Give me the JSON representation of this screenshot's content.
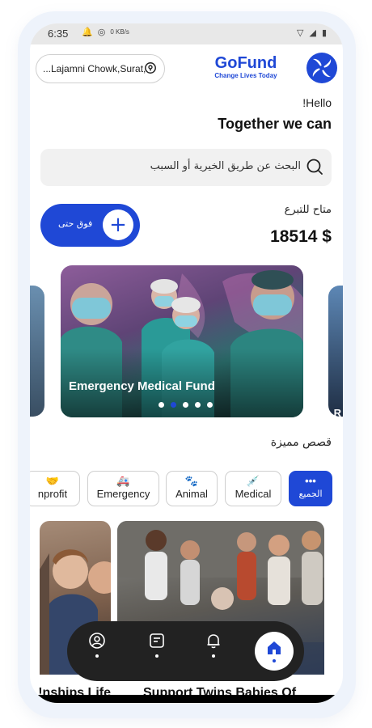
{
  "status_bar": {
    "time": "6:35",
    "network_speed": "0 KB/s"
  },
  "header": {
    "location": "...Lajamni Chowk,Surat,",
    "brand_title": "GoFund",
    "brand_tagline": "Change Lives Today"
  },
  "greeting": {
    "hello": "!Hello",
    "headline": "Together we can"
  },
  "search": {
    "placeholder": "البحث عن طريق الخيرية أو السبب"
  },
  "donate": {
    "button_label": "فوق حتى",
    "available_label": "متاح للتبرع",
    "available_amount": "18514 $"
  },
  "carousel": {
    "main_title": "Emergency Medical Fund",
    "side_right_letter": "R",
    "dots": 5,
    "active_dot_index": 1
  },
  "featured": {
    "title": "قصص مميزة"
  },
  "categories": [
    {
      "label": "nprofit",
      "icon": "handshake-icon"
    },
    {
      "label": "Emergency",
      "icon": "ambulance-icon"
    },
    {
      "label": "Animal",
      "icon": "paw-icon"
    },
    {
      "label": "Medical",
      "icon": "syringe-icon"
    },
    {
      "label": "الجميع",
      "icon": "dots-icon",
      "active": true
    }
  ],
  "cards": {
    "left_title": "nships Life!",
    "right_title": "Support Twins Babies Of"
  },
  "nav": {
    "items": [
      "profile",
      "notes",
      "notifications",
      "home"
    ],
    "active": "home"
  },
  "colors": {
    "accent": "#1f48d6",
    "nav_bg": "#222222"
  }
}
